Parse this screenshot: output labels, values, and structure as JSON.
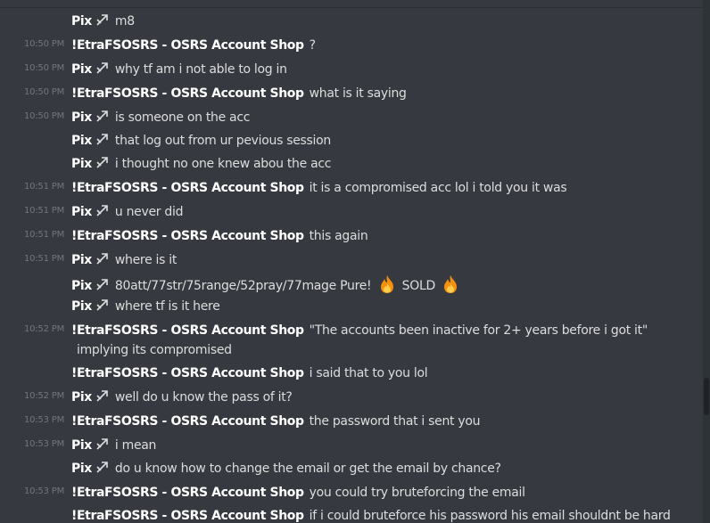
{
  "channel": {
    "users": {
      "pix": "Pix",
      "shop": "!EtraFSOSRS - OSRS Account Shop"
    },
    "messages": [
      {
        "time": "",
        "author": "Pix",
        "text": "m8"
      },
      {
        "time": "10:50 PM",
        "author": "!EtraFSOSRS - OSRS Account Shop",
        "text": "?"
      },
      {
        "time": "10:50 PM",
        "author": "Pix",
        "text": "why tf am i not able to log in"
      },
      {
        "time": "10:50 PM",
        "author": "!EtraFSOSRS - OSRS Account Shop",
        "text": "what is it saying"
      },
      {
        "time": "10:50 PM",
        "author": "Pix",
        "text": "is someone on the acc"
      },
      {
        "time": "",
        "author": "Pix",
        "text": "that log out from ur pevious session"
      },
      {
        "time": "",
        "author": "Pix",
        "text": "i thought no one knew abou the acc"
      },
      {
        "time": "10:51 PM",
        "author": "!EtraFSOSRS - OSRS Account Shop",
        "text": "it is a compromised acc lol i told you it was"
      },
      {
        "time": "10:51 PM",
        "author": "Pix",
        "text": "u never did"
      },
      {
        "time": "10:51 PM",
        "author": "!EtraFSOSRS - OSRS Account Shop",
        "text": "this again"
      },
      {
        "time": "10:51 PM",
        "author": "Pix",
        "text": "where is it"
      },
      {
        "time": "",
        "author": "Pix",
        "text": "80att/77str/75range/52pray/77mage Pure!",
        "text_after_fire": "SOLD"
      },
      {
        "time": "",
        "author": "Pix",
        "text": "where tf is it here"
      },
      {
        "time": "10:52 PM",
        "author": "!EtraFSOSRS - OSRS Account Shop",
        "text": "\"The accounts been inactive for 2+ years before i got it\"",
        "continuation": "implying its compromised"
      },
      {
        "time": "",
        "author": "!EtraFSOSRS - OSRS Account Shop",
        "text": "i said that to you lol"
      },
      {
        "time": "10:52 PM",
        "author": "Pix",
        "text": "well do u know the pass of it?"
      },
      {
        "time": "10:53 PM",
        "author": "!EtraFSOSRS - OSRS Account Shop",
        "text": "the password that i sent you"
      },
      {
        "time": "10:53 PM",
        "author": "Pix",
        "text": "i mean"
      },
      {
        "time": "",
        "author": "Pix",
        "text": "do u know how to change the email or get the email by chance?"
      },
      {
        "time": "10:53 PM",
        "author": "!EtraFSOSRS - OSRS Account Shop",
        "text": "you could try bruteforcing the email"
      },
      {
        "time": "",
        "author": "!EtraFSOSRS - OSRS Account Shop",
        "text": "if i could bruteforce his password his email shouldnt be hard"
      }
    ]
  },
  "icons": {
    "badge": "hunter-arrow-badge-icon",
    "emoji": "fire-emoji-icon"
  },
  "colors": {
    "background": "#36393f",
    "text": "#dcddde",
    "author": "#ffffff",
    "timestamp": "#72767d",
    "fire": "#f4900c"
  }
}
